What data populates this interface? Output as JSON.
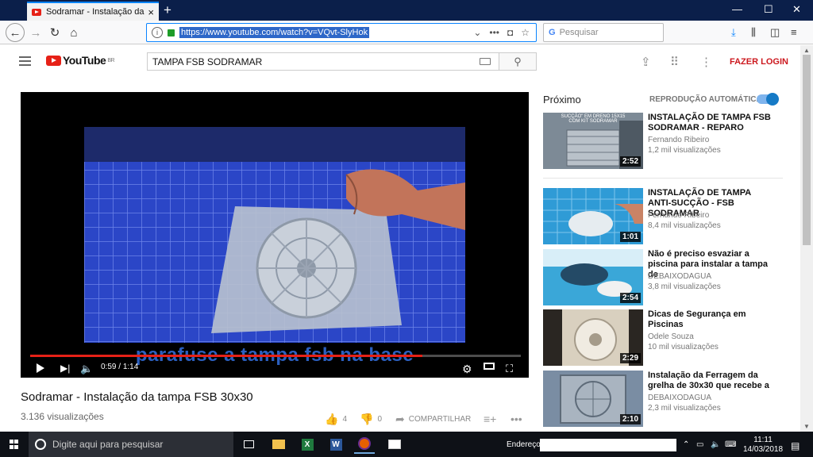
{
  "browser": {
    "tab_title": "Sodramar - Instalação da tampa",
    "tab_close": "×",
    "new_tab": "+",
    "url": "https://www.youtube.com/watch?v=VQvt-SlyHok",
    "search_placeholder": "Pesquisar",
    "window_min": "—",
    "window_max": "☐",
    "window_close": "✕"
  },
  "youtube": {
    "logo_text": "YouTube",
    "logo_region": "BR",
    "search_query": "TAMPA FSB SODRAMAR",
    "login_label": "FAZER LOGIN"
  },
  "player": {
    "caption": "parafuse a tampa fsb na base",
    "current_time": "0:59",
    "duration": "1:14",
    "progress": 0.8
  },
  "video": {
    "title": "Sodramar - Instalação da tampa FSB 30x30",
    "views": "3.136 visualizações",
    "likes": "4",
    "dislikes": "0",
    "share_label": "COMPARTILHAR"
  },
  "sidebar": {
    "next_label": "Próximo",
    "autoplay_label": "REPRODUÇÃO AUTOMÁTICA",
    "autoplay_on": true,
    "items": [
      {
        "title": "INSTALAÇÃO DE TAMPA FSB SODRAMAR - REPARO",
        "channel": "Fernando Ribeiro",
        "views": "1,2 mil visualizações",
        "duration": "2:52",
        "thumb_text": "SUCÇÃO\" EM DRENO 15X15 COM KIT SODRAMAR",
        "thumb_color": "#7d8a96"
      },
      {
        "title": "INSTALAÇÃO DE TAMPA ANTI-SUCÇÃO - FSB SODRAMAR",
        "channel": "Fernando Ribeiro",
        "views": "8,4 mil visualizações",
        "duration": "1:01",
        "thumb_text": "",
        "thumb_color": "#2f9bd6"
      },
      {
        "title": "Não é preciso esvaziar a piscina para instalar a tampa de",
        "channel": "DEBAIXODAGUA",
        "views": "3,8 mil visualizações",
        "duration": "2:54",
        "thumb_text": "",
        "thumb_color": "#3aa7d8"
      },
      {
        "title": "Dicas de Segurança em Piscinas",
        "channel": "Odele Souza",
        "views": "10 mil visualizações",
        "duration": "2:29",
        "thumb_text": "",
        "thumb_color": "#cfc6b6"
      },
      {
        "title": "Instalação da Ferragem da grelha de 30x30 que recebe a",
        "channel": "DEBAIXODAGUA",
        "views": "2,3 mil visualizações",
        "duration": "2:10",
        "thumb_text": "",
        "thumb_color": "#7a8da3"
      }
    ]
  },
  "taskbar": {
    "search_placeholder": "Digite aqui para pesquisar",
    "address_label": "Endereço",
    "time": "11:11",
    "date": "14/03/2018"
  },
  "colors": {
    "accent": "#0a84ff",
    "youtube_red": "#e62117",
    "login_red": "#cc181e",
    "toggle_blue": "#167ac6"
  }
}
